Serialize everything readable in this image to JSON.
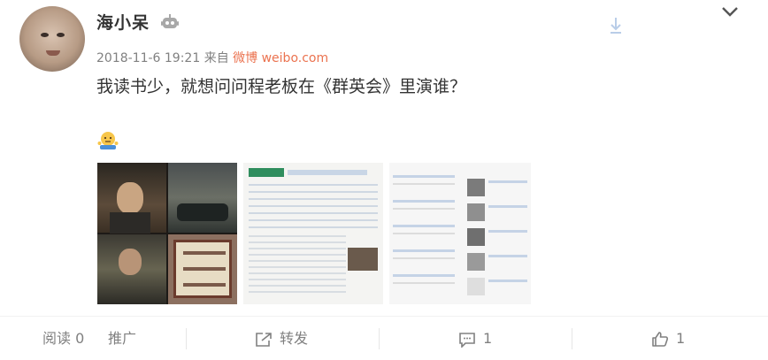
{
  "post": {
    "author": "海小呆",
    "timestamp": "2018-11-6 19:21",
    "via_label": "来自",
    "source_app": "微博 weibo.com",
    "text": "我读书少，就想问问程老板在《群英会》里演谁？"
  },
  "footer": {
    "read_label": "阅读",
    "read_count": "0",
    "promote_label": "推广",
    "repost_label": "转发",
    "comment_count": "1",
    "like_count": "1"
  },
  "colors": {
    "source_link": "#eb7350",
    "meta_text": "#808080",
    "body_text": "#333333"
  },
  "icons": [
    "robot-badge-icon",
    "download-icon",
    "chevron-down-icon",
    "shrug-emoji-icon",
    "repost-icon",
    "comment-icon",
    "like-icon"
  ]
}
